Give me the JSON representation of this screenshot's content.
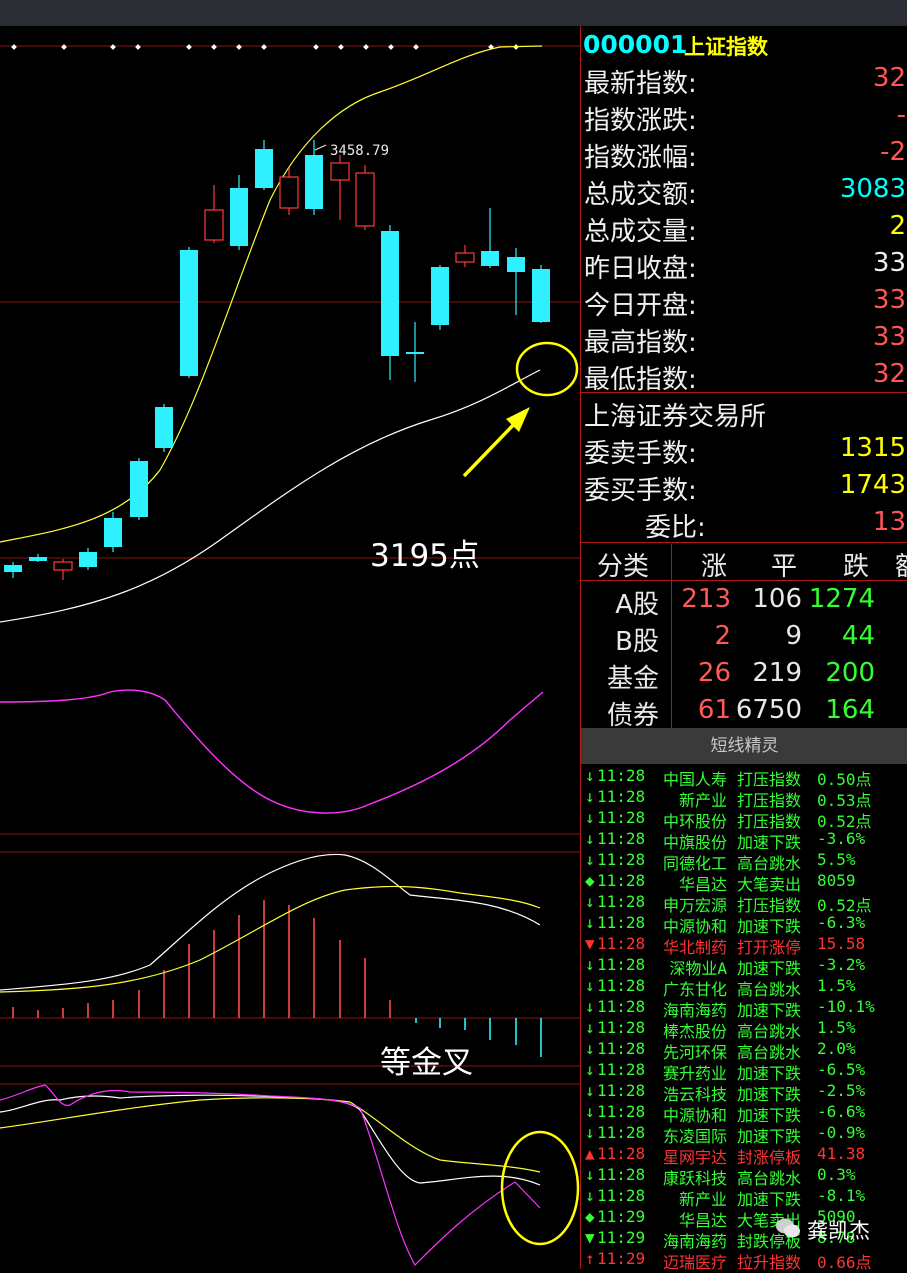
{
  "instrument": {
    "code": "000001",
    "name": "上证指数"
  },
  "chart": {
    "peak_label": "3458.79"
  },
  "annotations": {
    "price_point": "3195点",
    "cross_note": "等金叉"
  },
  "quote_rows": [
    {
      "label": "最新指数:",
      "value": "32",
      "color": "#ff5555"
    },
    {
      "label": "指数涨跌:",
      "value": "-",
      "color": "#ff5555"
    },
    {
      "label": "指数涨幅:",
      "value": "-2",
      "color": "#ff5555"
    },
    {
      "label": "总成交额:",
      "value": "3083",
      "color": "#00ffff"
    },
    {
      "label": "总成交量:",
      "value": "2",
      "color": "#ffff00"
    },
    {
      "label": "昨日收盘:",
      "value": "33",
      "color": "#f0f0f0"
    },
    {
      "label": "今日开盘:",
      "value": "33",
      "color": "#ff5555"
    },
    {
      "label": "最高指数:",
      "value": "33",
      "color": "#ff5555"
    },
    {
      "label": "最低指数:",
      "value": "32",
      "color": "#ff5555"
    }
  ],
  "exchange_label": "上海证券交易所",
  "order_rows": [
    {
      "label": "委卖手数:",
      "value": "1315",
      "color": "#ffff00"
    },
    {
      "label": "委买手数:",
      "value": "1743",
      "color": "#ffff00"
    },
    {
      "label": "委比:",
      "value": "13",
      "color": "#ff5555"
    }
  ],
  "breadth": {
    "headers": [
      "分类",
      "涨",
      "平",
      "跌",
      "额"
    ],
    "rows": [
      {
        "cat": "A股",
        "up": "213",
        "flat": "106",
        "down": "1274"
      },
      {
        "cat": "B股",
        "up": "2",
        "flat": "9",
        "down": "44"
      },
      {
        "cat": "基金",
        "up": "26",
        "flat": "219",
        "down": "200"
      },
      {
        "cat": "债券",
        "up": "61",
        "flat": "6750",
        "down": "164"
      }
    ]
  },
  "sprite_title": "短线精灵",
  "alerts": [
    {
      "icon": "↓",
      "time": "11:28",
      "name": "中国人寿",
      "event": "打压指数",
      "value": "0.50点",
      "color": "#33ff33"
    },
    {
      "icon": "↓",
      "time": "11:28",
      "name": "新产业",
      "event": "打压指数",
      "value": "0.53点",
      "color": "#33ff33"
    },
    {
      "icon": "↓",
      "time": "11:28",
      "name": "中环股份",
      "event": "打压指数",
      "value": "0.52点",
      "color": "#33ff33"
    },
    {
      "icon": "↓",
      "time": "11:28",
      "name": "中旗股份",
      "event": "加速下跌",
      "value": "-3.6%",
      "color": "#33ff33"
    },
    {
      "icon": "↓",
      "time": "11:28",
      "name": "同德化工",
      "event": "高台跳水",
      "value": "5.5%",
      "color": "#33ff33"
    },
    {
      "icon": "◆",
      "time": "11:28",
      "name": "华昌达",
      "event": "大笔卖出",
      "value": "8059",
      "color": "#33ff33"
    },
    {
      "icon": "↓",
      "time": "11:28",
      "name": "申万宏源",
      "event": "打压指数",
      "value": "0.52点",
      "color": "#33ff33"
    },
    {
      "icon": "↓",
      "time": "11:28",
      "name": "中源协和",
      "event": "加速下跌",
      "value": "-6.3%",
      "color": "#33ff33"
    },
    {
      "icon": "▼",
      "time": "11:28",
      "name": "华北制药",
      "event": "打开涨停",
      "value": "15.58",
      "color": "#ff3333"
    },
    {
      "icon": "↓",
      "time": "11:28",
      "name": "深物业A",
      "event": "加速下跌",
      "value": "-3.2%",
      "color": "#33ff33"
    },
    {
      "icon": "↓",
      "time": "11:28",
      "name": "广东甘化",
      "event": "高台跳水",
      "value": "1.5%",
      "color": "#33ff33"
    },
    {
      "icon": "↓",
      "time": "11:28",
      "name": "海南海药",
      "event": "加速下跌",
      "value": "-10.1%",
      "color": "#33ff33"
    },
    {
      "icon": "↓",
      "time": "11:28",
      "name": "棒杰股份",
      "event": "高台跳水",
      "value": "1.5%",
      "color": "#33ff33"
    },
    {
      "icon": "↓",
      "time": "11:28",
      "name": "先河环保",
      "event": "高台跳水",
      "value": "2.0%",
      "color": "#33ff33"
    },
    {
      "icon": "↓",
      "time": "11:28",
      "name": "赛升药业",
      "event": "加速下跌",
      "value": "-6.5%",
      "color": "#33ff33"
    },
    {
      "icon": "↓",
      "time": "11:28",
      "name": "浩云科技",
      "event": "加速下跌",
      "value": "-2.5%",
      "color": "#33ff33"
    },
    {
      "icon": "↓",
      "time": "11:28",
      "name": "中源协和",
      "event": "加速下跌",
      "value": "-6.6%",
      "color": "#33ff33"
    },
    {
      "icon": "↓",
      "time": "11:28",
      "name": "东凌国际",
      "event": "加速下跌",
      "value": "-0.9%",
      "color": "#33ff33"
    },
    {
      "icon": "▲",
      "time": "11:28",
      "name": "星网宇达",
      "event": "封涨停板",
      "value": "41.38",
      "color": "#ff3333"
    },
    {
      "icon": "↓",
      "time": "11:28",
      "name": "康跃科技",
      "event": "高台跳水",
      "value": "0.3%",
      "color": "#33ff33"
    },
    {
      "icon": "↓",
      "time": "11:28",
      "name": "新产业",
      "event": "加速下跌",
      "value": "-8.1%",
      "color": "#33ff33"
    },
    {
      "icon": "◆",
      "time": "11:29",
      "name": "华昌达",
      "event": "大笔卖出",
      "value": "5090",
      "color": "#33ff33"
    },
    {
      "icon": "▼",
      "time": "11:29",
      "name": "海南海药",
      "event": "封跌停板",
      "value": "8.78",
      "color": "#33ff33"
    },
    {
      "icon": "↑",
      "time": "11:29",
      "name": "迈瑞医疗",
      "event": "拉升指数",
      "value": "0.66点",
      "color": "#ff3333"
    }
  ],
  "watermark": "龚凯杰"
}
